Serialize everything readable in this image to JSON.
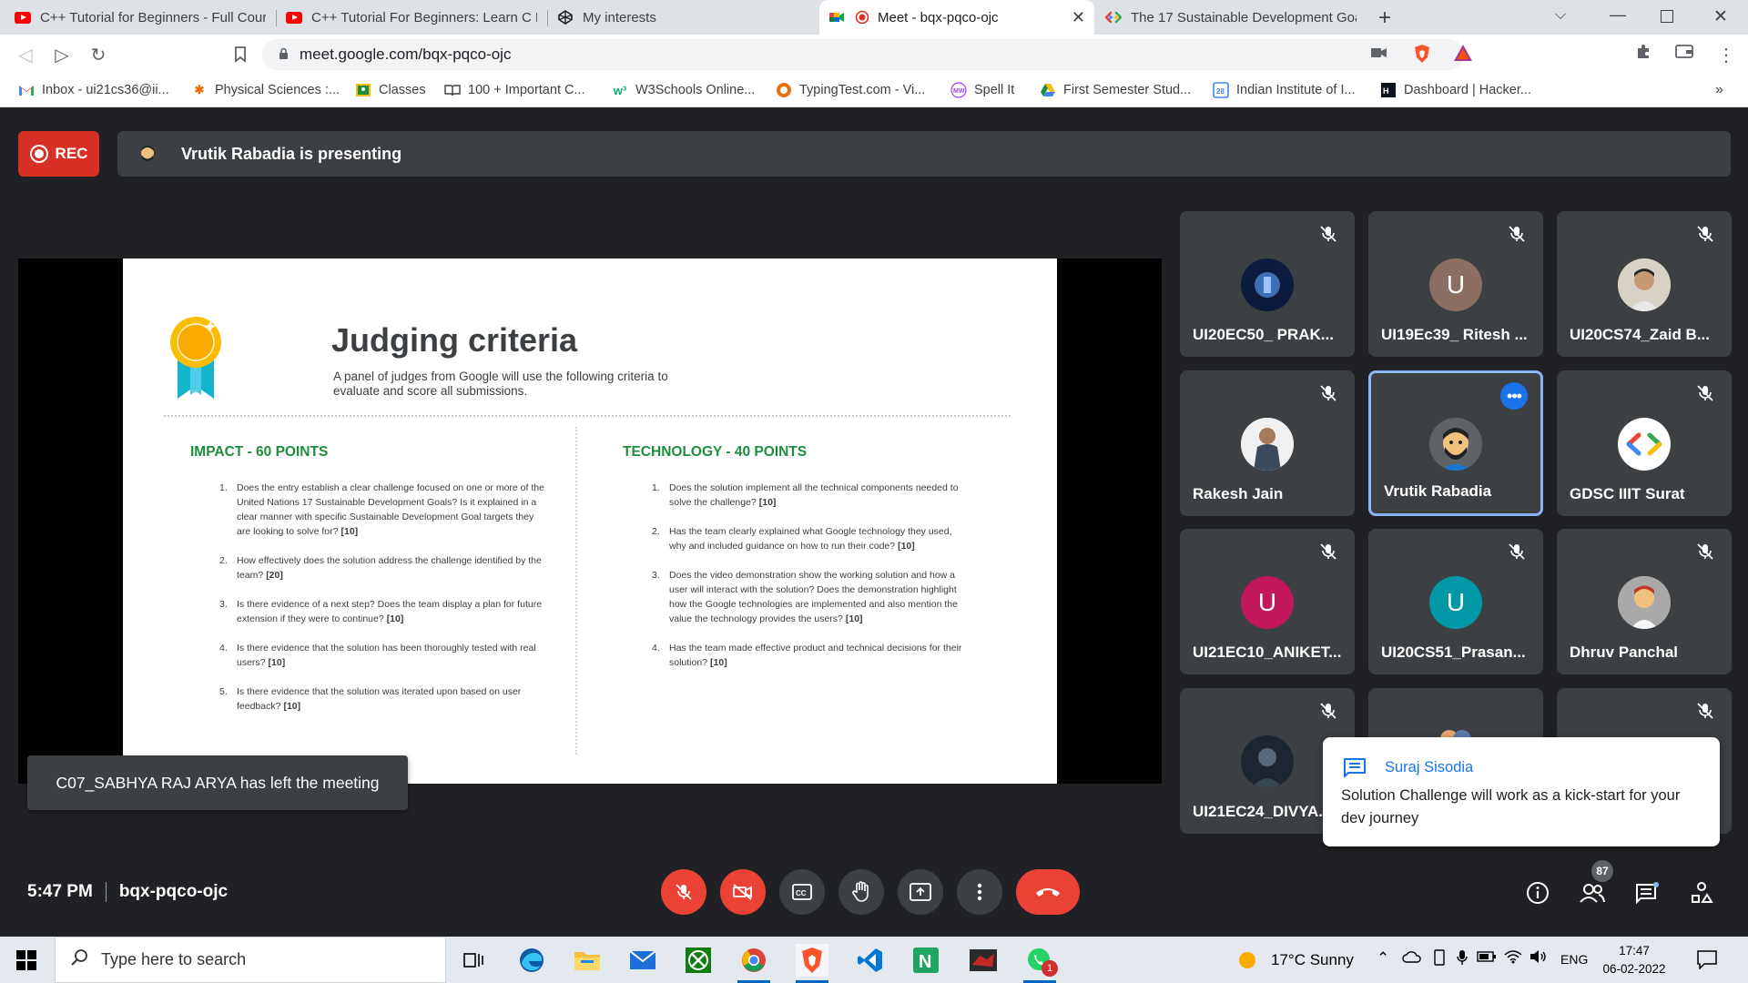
{
  "browser": {
    "tabs": [
      {
        "title": "C++ Tutorial for Beginners - Full Cour",
        "icon": "youtube-icon"
      },
      {
        "title": "C++ Tutorial For Beginners: Learn C Pl",
        "icon": "youtube-icon"
      },
      {
        "title": "My interests",
        "icon": "codepen-icon"
      },
      {
        "title": "Meet - bqx-pqco-ojc",
        "icon": "meet-icon"
      },
      {
        "title": "The 17 Sustainable Development Goa",
        "icon": "gdsc-icon"
      }
    ],
    "active_tab": 3,
    "url": "meet.google.com/bqx-pqco-ojc",
    "bookmarks": [
      {
        "label": "Inbox - ui21cs36@ii...",
        "icon": "gmail-icon"
      },
      {
        "label": "Physical Sciences :...",
        "icon": "physics-icon"
      },
      {
        "label": "Classes",
        "icon": "classroom-icon"
      },
      {
        "label": "100 + Important C...",
        "icon": "book-icon"
      },
      {
        "label": "W3Schools Online...",
        "icon": "w3schools-icon"
      },
      {
        "label": "TypingTest.com - Vi...",
        "icon": "typingtest-icon"
      },
      {
        "label": "Spell It",
        "icon": "spellit-icon"
      },
      {
        "label": "First Semester Stud...",
        "icon": "drive-icon"
      },
      {
        "label": "Indian Institute of I...",
        "icon": "calendar-icon"
      },
      {
        "label": "Dashboard | Hacker...",
        "icon": "hackerrank-icon"
      }
    ],
    "more_bookmarks": "»"
  },
  "meet": {
    "rec_label": "REC",
    "presenting_text": "Vrutik Rabadia is presenting",
    "slide": {
      "title": "Judging criteria",
      "subtitle": "A panel of judges from Google will use the following criteria to evaluate and score all submissions.",
      "impact": {
        "heading": "IMPACT - 60 POINTS",
        "items": [
          {
            "n": "1.",
            "text": "Does the entry establish a clear challenge focused on one or more of the United Nations 17 Sustainable Development Goals? Is it explained in a clear manner with specific Sustainable Development Goal targets they are looking to solve for?",
            "points": "[10]"
          },
          {
            "n": "2.",
            "text": "How effectively does the solution address the challenge identified by the team?",
            "points": "[20]"
          },
          {
            "n": "3.",
            "text": "Is there evidence of a next step? Does the team display a plan for future extension if they were to continue?",
            "points": "[10]"
          },
          {
            "n": "4.",
            "text": "Is there evidence that the solution has been thoroughly tested with real users?",
            "points": "[10]"
          },
          {
            "n": "5.",
            "text": "Is there evidence that the solution was iterated upon based on user feedback?",
            "points": "[10]"
          }
        ]
      },
      "technology": {
        "heading": "TECHNOLOGY - 40 POINTS",
        "items": [
          {
            "n": "1.",
            "text": "Does the solution implement all the technical components needed to solve the challenge?",
            "points": "[10]"
          },
          {
            "n": "2.",
            "text": "Has the team clearly explained what Google technology they used, why and included guidance on how to run their code?",
            "points": "[10]"
          },
          {
            "n": "3.",
            "text": "Does the video demonstration show the working solution and how a user will interact with the solution? Does the demonstration highlight how the Google technologies are implemented and also mention the value the technology provides the users?",
            "points": "[10]"
          },
          {
            "n": "4.",
            "text": "Has the team made effective product and technical decisions for their solution?",
            "points": "[10]"
          }
        ]
      }
    },
    "participants": [
      {
        "name": "UI20EC50_ PRAK...",
        "avatar": "photo",
        "color": "#1b3a6b"
      },
      {
        "name": "UI19Ec39_ Ritesh ...",
        "avatar": "U",
        "color": "#8d6e63"
      },
      {
        "name": "UI20CS74_Zaid B...",
        "avatar": "photo",
        "color": "#cfc6b8"
      },
      {
        "name": "Rakesh Jain",
        "avatar": "photo",
        "color": "#e8e8e8"
      },
      {
        "name": "Vrutik Rabadia",
        "avatar": "emoji",
        "color": "#5f6368"
      },
      {
        "name": "GDSC IIIT Surat",
        "avatar": "gdsc",
        "color": "#ffffff"
      },
      {
        "name": "UI21EC10_ANIKET...",
        "avatar": "U",
        "color": "#c2185b"
      },
      {
        "name": "UI20CS51_Prasan...",
        "avatar": "U",
        "color": "#0097a7"
      },
      {
        "name": "Dhruv Panchal",
        "avatar": "emoji",
        "color": "#9e9e9e"
      },
      {
        "name": "UI21EC24_DIVYA...",
        "avatar": "photo",
        "color": "#263238"
      }
    ],
    "left_toast": "C07_SABHYA RAJ ARYA has left the meeting",
    "chat_popup": {
      "from": "Suraj Sisodia",
      "message": "Solution Challenge will work as a kick-start for your dev journey"
    },
    "time": "5:47 PM",
    "meeting_code": "bqx-pqco-ojc",
    "participant_count": "87",
    "colors": {
      "red": "#ea4335",
      "tile": "#3c4043",
      "accent": "#1a73e8",
      "green_heading": "#1e8e3e"
    }
  },
  "taskbar": {
    "search_placeholder": "Type here to search",
    "weather": "17°C  Sunny",
    "language": "ENG",
    "time": "17:47",
    "date": "06-02-2022",
    "whatsapp_badge": "1"
  }
}
